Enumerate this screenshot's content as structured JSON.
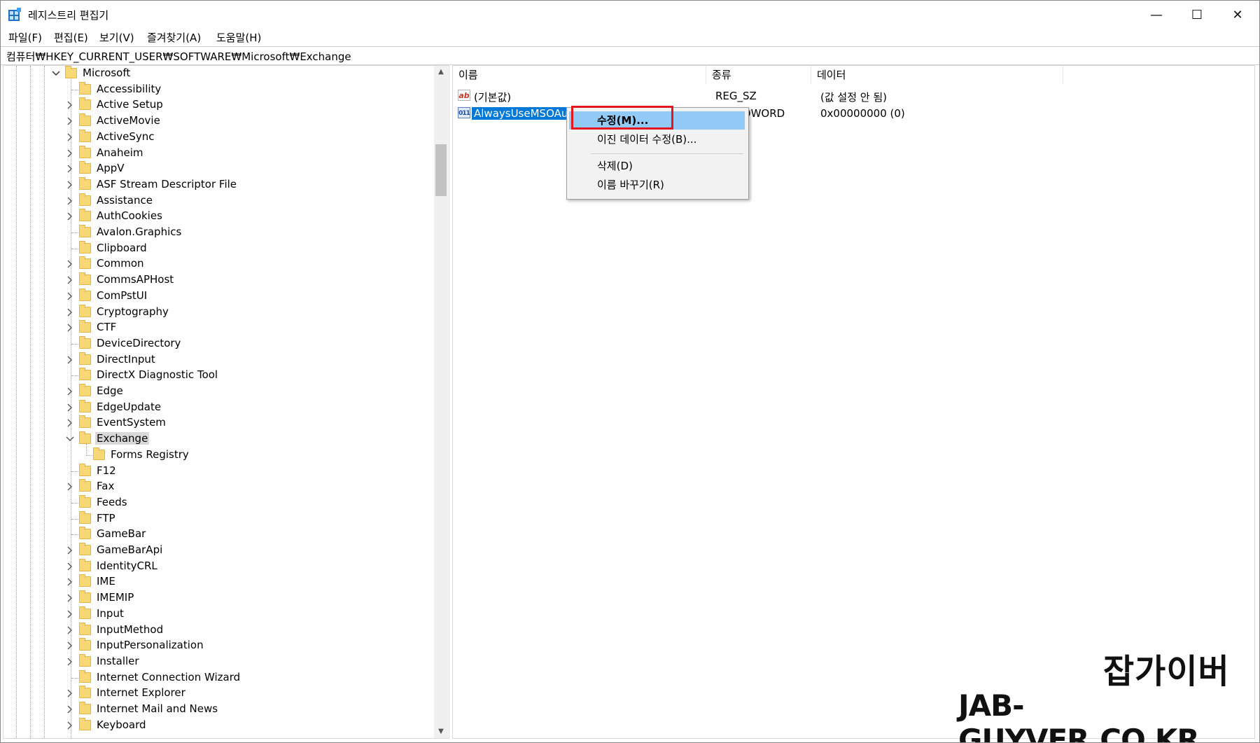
{
  "window": {
    "title": "레지스트리 편집기",
    "minimize": "—",
    "maximize": "☐",
    "close": "✕"
  },
  "menu": [
    "파일(F)",
    "편집(E)",
    "보기(V)",
    "즐겨찾기(A)",
    "도움말(H)"
  ],
  "address": "컴퓨터₩HKEY_CURRENT_USER₩SOFTWARE₩Microsoft₩Exchange",
  "tree": {
    "root": {
      "label": "Microsoft",
      "expanded": true
    },
    "items": [
      {
        "label": "Accessibility",
        "expandable": false
      },
      {
        "label": "Active Setup",
        "expandable": true
      },
      {
        "label": "ActiveMovie",
        "expandable": true
      },
      {
        "label": "ActiveSync",
        "expandable": true
      },
      {
        "label": "Anaheim",
        "expandable": true
      },
      {
        "label": "AppV",
        "expandable": true
      },
      {
        "label": "ASF Stream Descriptor File",
        "expandable": true
      },
      {
        "label": "Assistance",
        "expandable": true
      },
      {
        "label": "AuthCookies",
        "expandable": true
      },
      {
        "label": "Avalon.Graphics",
        "expandable": false
      },
      {
        "label": "Clipboard",
        "expandable": false
      },
      {
        "label": "Common",
        "expandable": true
      },
      {
        "label": "CommsAPHost",
        "expandable": true
      },
      {
        "label": "ComPstUI",
        "expandable": true
      },
      {
        "label": "Cryptography",
        "expandable": true
      },
      {
        "label": "CTF",
        "expandable": true
      },
      {
        "label": "DeviceDirectory",
        "expandable": false
      },
      {
        "label": "DirectInput",
        "expandable": true
      },
      {
        "label": "DirectX Diagnostic Tool",
        "expandable": false
      },
      {
        "label": "Edge",
        "expandable": true
      },
      {
        "label": "EdgeUpdate",
        "expandable": true
      },
      {
        "label": "EventSystem",
        "expandable": true
      },
      {
        "label": "Exchange",
        "expandable": true,
        "expanded": true,
        "selected": true
      },
      {
        "label": "Forms Registry",
        "expandable": false,
        "child": true
      },
      {
        "label": "F12",
        "expandable": false
      },
      {
        "label": "Fax",
        "expandable": true
      },
      {
        "label": "Feeds",
        "expandable": false
      },
      {
        "label": "FTP",
        "expandable": false
      },
      {
        "label": "GameBar",
        "expandable": false
      },
      {
        "label": "GameBarApi",
        "expandable": true
      },
      {
        "label": "IdentityCRL",
        "expandable": true
      },
      {
        "label": "IME",
        "expandable": true
      },
      {
        "label": "IMEMIP",
        "expandable": true
      },
      {
        "label": "Input",
        "expandable": true
      },
      {
        "label": "InputMethod",
        "expandable": true
      },
      {
        "label": "InputPersonalization",
        "expandable": true
      },
      {
        "label": "Installer",
        "expandable": true
      },
      {
        "label": "Internet Connection Wizard",
        "expandable": false
      },
      {
        "label": "Internet Explorer",
        "expandable": true
      },
      {
        "label": "Internet Mail and News",
        "expandable": true
      },
      {
        "label": "Keyboard",
        "expandable": true
      }
    ]
  },
  "values": {
    "headers": {
      "name": "이름",
      "type": "종류",
      "data": "데이터"
    },
    "rows": [
      {
        "icon": "ab",
        "name": "(기본값)",
        "type": "REG_SZ",
        "data": "(값 설정 안 됨)",
        "selected": false
      },
      {
        "icon": "011",
        "name": "AlwaysUseMSOAuthForAutoDiscover",
        "type": "REG_DWORD",
        "data": "0x00000000 (0)",
        "selected": true
      }
    ]
  },
  "context_menu": {
    "items": [
      "수정(M)...",
      "이진 데이터 수정(B)...",
      "삭제(D)",
      "이름 바꾸기(R)"
    ]
  },
  "watermark": {
    "korean": "잡가이버",
    "url": "JAB-GUYVER.CO.KR"
  },
  "colors": {
    "selection": "#0078d7",
    "menu_hover": "#91c9f7",
    "highlight": "#e3161d",
    "folder": "#f8d775"
  }
}
